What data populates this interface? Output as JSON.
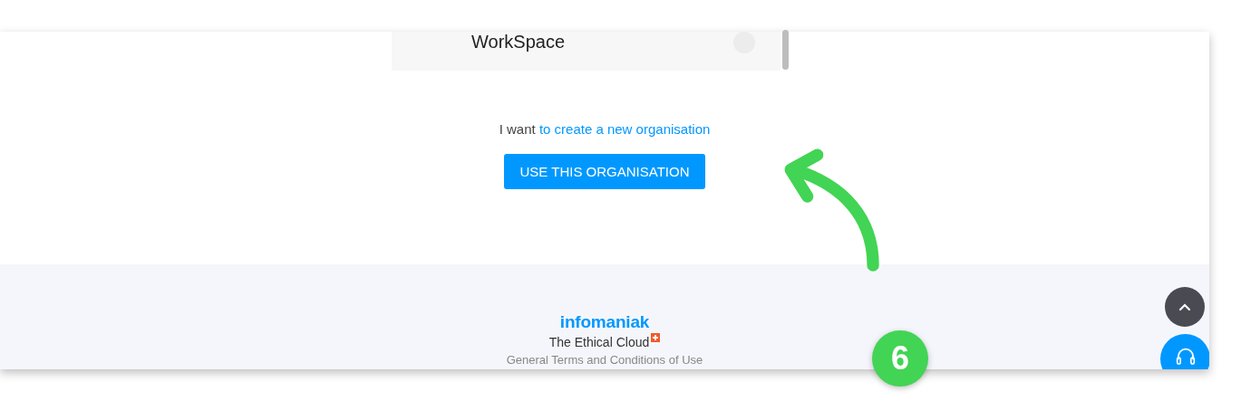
{
  "organisations": [
    {
      "label": "WorkSpace",
      "selected": false
    }
  ],
  "prompt": {
    "text": "I want",
    "link": "to create a new organisation"
  },
  "primary_button": "USE THIS ORGANISATION",
  "footer": {
    "logo": "infomaniak",
    "tagline": "The Ethical Cloud",
    "link": "General Terms and Conditions of Use"
  },
  "step_badge": "6"
}
